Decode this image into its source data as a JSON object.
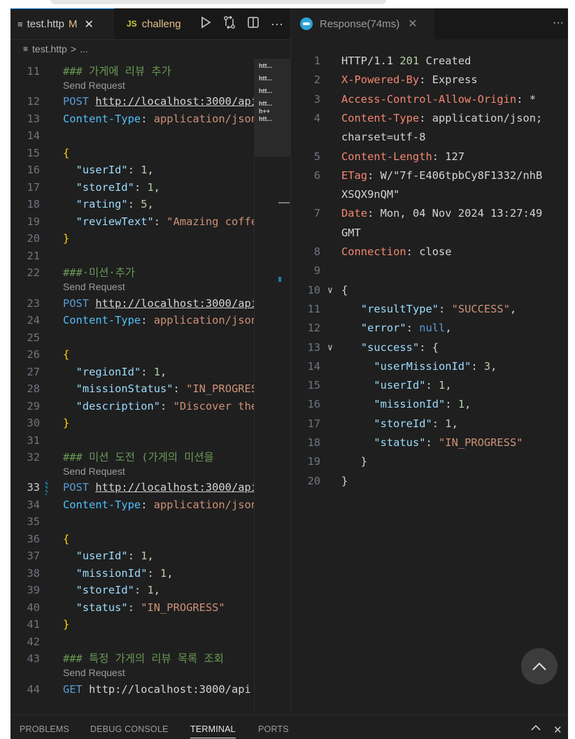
{
  "left_tabs": [
    {
      "label": "test.http",
      "badge": "M",
      "icon": "file-lines-icon"
    },
    {
      "label": "challeng",
      "icon": "js-icon",
      "icon_text": "JS"
    }
  ],
  "left_actions": [
    "run-icon",
    "compare-icon",
    "split-editor-icon",
    "more-icon"
  ],
  "breadcrumb": {
    "file": "test.http",
    "separator": ">",
    "rest": "..."
  },
  "send_request": "Send Request",
  "left_lines": [
    {
      "n": "11",
      "parts": [
        [
          "cmt",
          "### 가게에 리뷰 추가"
        ]
      ],
      "lens": true
    },
    {
      "n": "12",
      "parts": [
        [
          "kw",
          "POST"
        ],
        [
          "punc",
          " "
        ],
        [
          "url",
          "http://localhost:3000/api"
        ]
      ]
    },
    {
      "n": "13",
      "parts": [
        [
          "hdr",
          "Content-Type"
        ],
        [
          "punc",
          ": "
        ],
        [
          "val",
          "application/json"
        ]
      ]
    },
    {
      "n": "14",
      "parts": []
    },
    {
      "n": "15",
      "parts": [
        [
          "brace",
          "{"
        ]
      ]
    },
    {
      "n": "16",
      "parts": [
        [
          "punc",
          "  "
        ],
        [
          "key",
          "\"userId\""
        ],
        [
          "punc",
          ": "
        ],
        [
          "num",
          "1"
        ],
        [
          "punc",
          ","
        ]
      ]
    },
    {
      "n": "17",
      "parts": [
        [
          "punc",
          "  "
        ],
        [
          "key",
          "\"storeId\""
        ],
        [
          "punc",
          ": "
        ],
        [
          "num",
          "1"
        ],
        [
          "punc",
          ","
        ]
      ]
    },
    {
      "n": "18",
      "parts": [
        [
          "punc",
          "  "
        ],
        [
          "key",
          "\"rating\""
        ],
        [
          "punc",
          ": "
        ],
        [
          "num",
          "5"
        ],
        [
          "punc",
          ","
        ]
      ]
    },
    {
      "n": "19",
      "parts": [
        [
          "punc",
          "  "
        ],
        [
          "key",
          "\"reviewText\""
        ],
        [
          "punc",
          ": "
        ],
        [
          "str",
          "\"Amazing coffee"
        ]
      ]
    },
    {
      "n": "20",
      "parts": [
        [
          "brace",
          "}"
        ]
      ]
    },
    {
      "n": "21",
      "parts": []
    },
    {
      "n": "22",
      "parts": [
        [
          "cmt",
          "###·미션·추가"
        ]
      ],
      "lens": true
    },
    {
      "n": "23",
      "parts": [
        [
          "kw",
          "POST"
        ],
        [
          "punc",
          " "
        ],
        [
          "url",
          "http://localhost:3000/api"
        ]
      ]
    },
    {
      "n": "24",
      "parts": [
        [
          "hdr",
          "Content-Type"
        ],
        [
          "punc",
          ": "
        ],
        [
          "val",
          "application/json"
        ]
      ]
    },
    {
      "n": "25",
      "parts": []
    },
    {
      "n": "26",
      "parts": [
        [
          "brace",
          "{"
        ]
      ]
    },
    {
      "n": "27",
      "parts": [
        [
          "punc",
          "  "
        ],
        [
          "key",
          "\"regionId\""
        ],
        [
          "punc",
          ": "
        ],
        [
          "num",
          "1"
        ],
        [
          "punc",
          ","
        ]
      ]
    },
    {
      "n": "28",
      "parts": [
        [
          "punc",
          "  "
        ],
        [
          "key",
          "\"missionStatus\""
        ],
        [
          "punc",
          ": "
        ],
        [
          "str",
          "\"IN_PROGRESS\""
        ]
      ]
    },
    {
      "n": "29",
      "parts": [
        [
          "punc",
          "  "
        ],
        [
          "key",
          "\"description\""
        ],
        [
          "punc",
          ": "
        ],
        [
          "str",
          "\"Discover the"
        ]
      ]
    },
    {
      "n": "30",
      "parts": [
        [
          "brace",
          "}"
        ]
      ]
    },
    {
      "n": "31",
      "parts": []
    },
    {
      "n": "32",
      "parts": [
        [
          "cmt",
          "### 미션 도전 (가게의 미션을"
        ]
      ],
      "lens": true
    },
    {
      "n": "33",
      "parts": [
        [
          "kw",
          "POST"
        ],
        [
          "punc",
          " "
        ],
        [
          "url",
          "http://localhost:3000/api"
        ]
      ],
      "current": true
    },
    {
      "n": "34",
      "parts": [
        [
          "hdr",
          "Content-Type"
        ],
        [
          "punc",
          ": "
        ],
        [
          "val",
          "application/json"
        ]
      ]
    },
    {
      "n": "35",
      "parts": []
    },
    {
      "n": "36",
      "parts": [
        [
          "brace",
          "{"
        ]
      ]
    },
    {
      "n": "37",
      "parts": [
        [
          "punc",
          "  "
        ],
        [
          "key",
          "\"userId\""
        ],
        [
          "punc",
          ": "
        ],
        [
          "num",
          "1"
        ],
        [
          "punc",
          ","
        ]
      ]
    },
    {
      "n": "38",
      "parts": [
        [
          "punc",
          "  "
        ],
        [
          "key",
          "\"missionId\""
        ],
        [
          "punc",
          ": "
        ],
        [
          "num",
          "1"
        ],
        [
          "punc",
          ","
        ]
      ]
    },
    {
      "n": "39",
      "parts": [
        [
          "punc",
          "  "
        ],
        [
          "key",
          "\"storeId\""
        ],
        [
          "punc",
          ": "
        ],
        [
          "num",
          "1"
        ],
        [
          "punc",
          ","
        ]
      ]
    },
    {
      "n": "40",
      "parts": [
        [
          "punc",
          "  "
        ],
        [
          "key",
          "\"status\""
        ],
        [
          "punc",
          ": "
        ],
        [
          "str",
          "\"IN_PROGRESS\""
        ]
      ]
    },
    {
      "n": "41",
      "parts": [
        [
          "brace",
          "}"
        ]
      ]
    },
    {
      "n": "42",
      "parts": []
    },
    {
      "n": "43",
      "parts": [
        [
          "cmt",
          "### 특정 가게의 리뷰 목록 조회"
        ]
      ],
      "lens": true
    },
    {
      "n": "44",
      "parts": [
        [
          "kw",
          "GET"
        ],
        [
          "punc",
          " "
        ],
        [
          "punc",
          "http://localhost:3000/api"
        ]
      ]
    }
  ],
  "minimap_labels": [
    "htt...",
    "htt...",
    "htt...",
    "htt...",
    "h++",
    "htt..."
  ],
  "right_tab": {
    "label": "Response(74ms)",
    "icon": "rest-client-icon"
  },
  "response_lines": [
    {
      "n": "1",
      "parts": [
        [
          "h-plain",
          "HTTP/1.1 "
        ],
        [
          "h-ok",
          "201"
        ],
        [
          "h-plain",
          " Created"
        ]
      ]
    },
    {
      "n": "2",
      "parts": [
        [
          "h-name",
          "X-Powered-By"
        ],
        [
          "h-plain",
          ": Express"
        ]
      ]
    },
    {
      "n": "3",
      "parts": [
        [
          "h-name",
          "Access-Control-Allow-Origin"
        ],
        [
          "h-plain",
          ": *"
        ]
      ]
    },
    {
      "n": "4",
      "parts": [
        [
          "h-name",
          "Content-Type"
        ],
        [
          "h-plain",
          ": application/json;"
        ]
      ]
    },
    {
      "n": "",
      "parts": [
        [
          "h-plain",
          "charset=utf-8"
        ]
      ]
    },
    {
      "n": "5",
      "parts": [
        [
          "h-name",
          "Content-Length"
        ],
        [
          "h-plain",
          ": 127"
        ]
      ]
    },
    {
      "n": "6",
      "parts": [
        [
          "h-name",
          "ETag"
        ],
        [
          "h-plain",
          ": W/\"7f-E406tpbCy8F1332/nhB"
        ]
      ]
    },
    {
      "n": "",
      "parts": [
        [
          "h-plain",
          "XSQX9nQM\""
        ]
      ]
    },
    {
      "n": "7",
      "parts": [
        [
          "h-name",
          "Date"
        ],
        [
          "h-plain",
          ": Mon, 04 Nov 2024 13:27:49"
        ]
      ]
    },
    {
      "n": "",
      "parts": [
        [
          "h-plain",
          "GMT"
        ]
      ]
    },
    {
      "n": "8",
      "parts": [
        [
          "h-name",
          "Connection"
        ],
        [
          "h-plain",
          ": close"
        ]
      ]
    },
    {
      "n": "9",
      "parts": []
    },
    {
      "n": "10",
      "fold": "∨",
      "parts": [
        [
          "h-plain",
          "{"
        ]
      ]
    },
    {
      "n": "11",
      "parts": [
        [
          "h-plain",
          "   "
        ],
        [
          "jkey",
          "\"resultType\""
        ],
        [
          "h-plain",
          ": "
        ],
        [
          "jstr",
          "\"SUCCESS\""
        ],
        [
          "h-plain",
          ","
        ]
      ]
    },
    {
      "n": "12",
      "parts": [
        [
          "h-plain",
          "   "
        ],
        [
          "jkey",
          "\"error\""
        ],
        [
          "h-plain",
          ": "
        ],
        [
          "jkw",
          "null"
        ],
        [
          "h-plain",
          ","
        ]
      ]
    },
    {
      "n": "13",
      "fold": "∨",
      "parts": [
        [
          "h-plain",
          "   "
        ],
        [
          "jkey",
          "\"success\""
        ],
        [
          "h-plain",
          ": {"
        ]
      ]
    },
    {
      "n": "14",
      "parts": [
        [
          "h-plain",
          "     "
        ],
        [
          "jkey",
          "\"userMissionId\""
        ],
        [
          "h-plain",
          ": "
        ],
        [
          "jnum",
          "3"
        ],
        [
          "h-plain",
          ","
        ]
      ]
    },
    {
      "n": "15",
      "parts": [
        [
          "h-plain",
          "     "
        ],
        [
          "jkey",
          "\"userId\""
        ],
        [
          "h-plain",
          ": "
        ],
        [
          "jnum",
          "1"
        ],
        [
          "h-plain",
          ","
        ]
      ]
    },
    {
      "n": "16",
      "parts": [
        [
          "h-plain",
          "     "
        ],
        [
          "jkey",
          "\"missionId\""
        ],
        [
          "h-plain",
          ": "
        ],
        [
          "jnum",
          "1"
        ],
        [
          "h-plain",
          ","
        ]
      ]
    },
    {
      "n": "17",
      "parts": [
        [
          "h-plain",
          "     "
        ],
        [
          "jkey",
          "\"storeId\""
        ],
        [
          "h-plain",
          ": "
        ],
        [
          "jnum",
          "1"
        ],
        [
          "h-plain",
          ","
        ]
      ]
    },
    {
      "n": "18",
      "parts": [
        [
          "h-plain",
          "     "
        ],
        [
          "jkey",
          "\"status\""
        ],
        [
          "h-plain",
          ": "
        ],
        [
          "jstr",
          "\"IN_PROGRESS\""
        ]
      ]
    },
    {
      "n": "19",
      "parts": [
        [
          "h-plain",
          "   }"
        ]
      ]
    },
    {
      "n": "20",
      "parts": [
        [
          "h-plain",
          "}"
        ]
      ]
    }
  ],
  "panel_tabs": [
    {
      "label": "PROBLEMS",
      "active": false
    },
    {
      "label": "DEBUG CONSOLE",
      "active": false
    },
    {
      "label": "TERMINAL",
      "active": true
    },
    {
      "label": "PORTS",
      "active": false
    }
  ],
  "panel_actions": [
    "chevron-up-icon",
    "close-icon"
  ],
  "colors": {
    "editor_bg": "#1f1f1f",
    "tab_bar_bg": "#181818",
    "accent": "#0078d4",
    "comment": "#6a9955",
    "keyword": "#569cd6",
    "string": "#ce9178",
    "json_key": "#9cdcfe",
    "header_name": "#f48771"
  }
}
